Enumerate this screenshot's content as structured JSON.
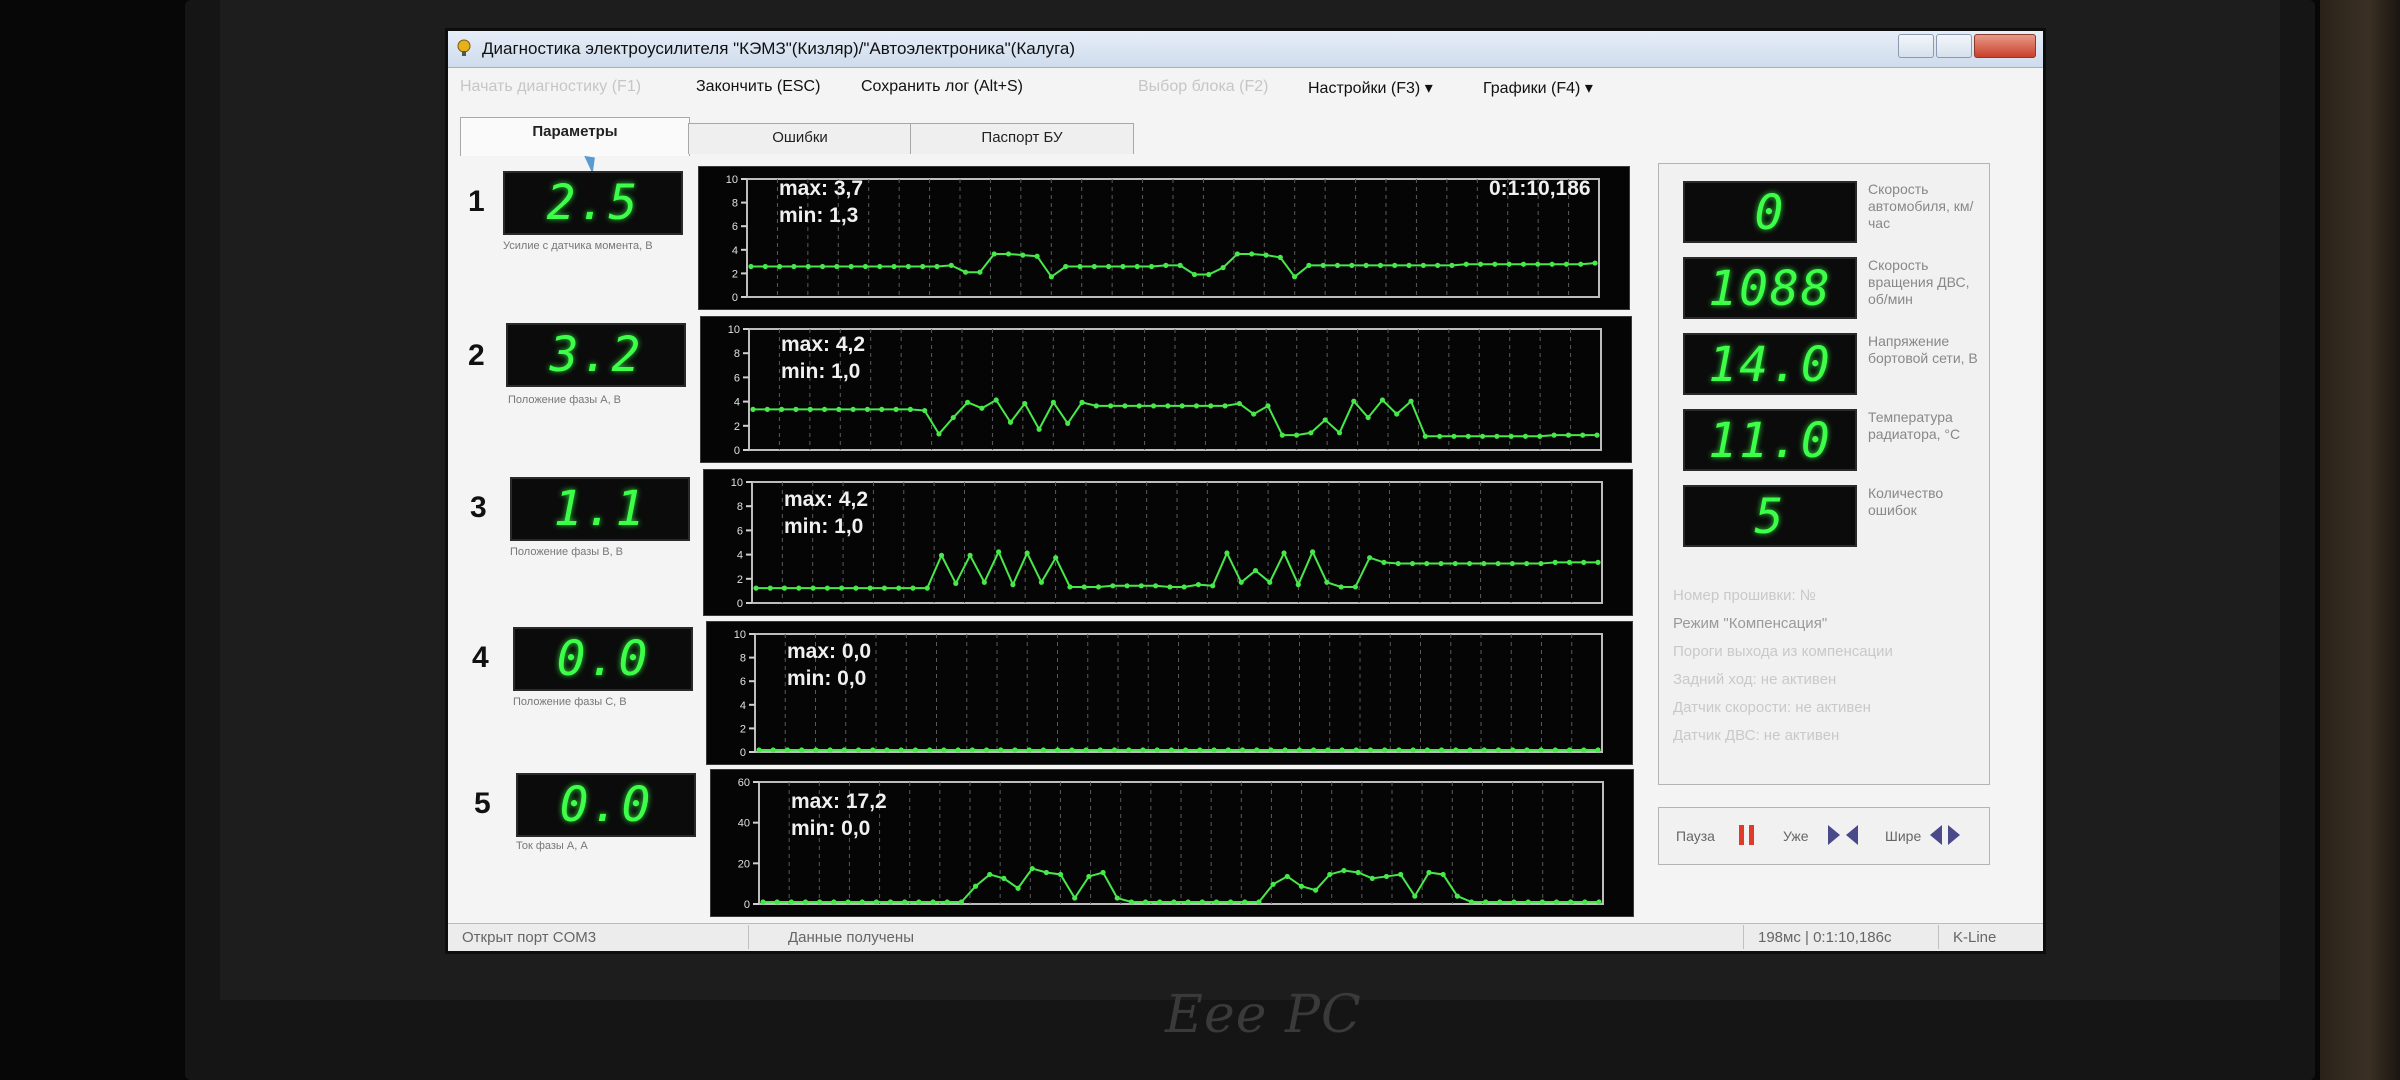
{
  "window": {
    "title": "Диагностика электроусилителя \"КЭМЗ\"(Кизляр)/\"Автоэлектроника\"(Калуга)"
  },
  "menu": {
    "start": "Начать диагностику (F1)",
    "finish": "Закончить (ESC)",
    "save_log": "Сохранить лог (Alt+S)",
    "select_block": "Выбор блока (F2)",
    "settings": "Настройки (F3)",
    "graphs": "Графики (F4)"
  },
  "tabs": [
    {
      "label": "Параметры",
      "active": true
    },
    {
      "label": "Ошибки",
      "active": false
    },
    {
      "label": "Паспорт БУ",
      "active": false
    }
  ],
  "params": [
    {
      "num": "1",
      "value": "2.5",
      "label": "Усилие с датчика момента, В",
      "max": "max: 3,7",
      "min": "min: 1,3",
      "ymax": 10,
      "yticks": [
        "10",
        "8",
        "6",
        "4",
        "2",
        "0"
      ]
    },
    {
      "num": "2",
      "value": "3.2",
      "label": "Положение фазы А, В",
      "max": "max: 4,2",
      "min": "min: 1,0",
      "ymax": 10,
      "yticks": [
        "10",
        "8",
        "6",
        "4",
        "2",
        "0"
      ]
    },
    {
      "num": "3",
      "value": "1.1",
      "label": "Положение фазы В, В",
      "max": "max: 4,2",
      "min": "min: 1,0",
      "ymax": 10,
      "yticks": [
        "10",
        "8",
        "6",
        "4",
        "2",
        "0"
      ]
    },
    {
      "num": "4",
      "value": "0.0",
      "label": "Положение фазы С, В",
      "max": "max: 0,0",
      "min": "min: 0,0",
      "ymax": 10,
      "yticks": [
        "10",
        "8",
        "6",
        "4",
        "2",
        "0"
      ]
    },
    {
      "num": "5",
      "value": "0.0",
      "label": "Ток фазы А, А",
      "max": "max: 17,2",
      "min": "min: 0,0",
      "ymax": 60,
      "yticks": [
        "60",
        "40",
        "20",
        "0"
      ]
    }
  ],
  "graph_time": "0:1:10,186",
  "side": [
    {
      "value": "0",
      "label": "Скорость автомобиля, км/час"
    },
    {
      "value": "1088",
      "label": "Скорость вращения ДВС, об/мин"
    },
    {
      "value": "14.0",
      "label": "Напряжение бортовой сети, В"
    },
    {
      "value": "11.0",
      "label": "Температура радиатора, °С"
    },
    {
      "value": "5",
      "label": "Количество ошибок"
    }
  ],
  "side_text": {
    "line1": "Номер прошивки: №",
    "mode": "Режим \"Компенсация\"",
    "line3": "Пороги выхода из компенсации",
    "line4": "Задний ход: не активен",
    "line5": "Датчик скорости: не активен",
    "line6": "Датчик ДВС: не активен"
  },
  "controls": {
    "pause": "Пауза",
    "narrower": "Уже",
    "wider": "Шире"
  },
  "status": {
    "port": "Открыт порт COM3",
    "data": "Данные получены",
    "timing": "198мс | 0:1:10,186с",
    "protocol": "K-Line"
  },
  "colors": {
    "trace": "#46e84a",
    "seg_digit": "#3dff4a",
    "plot_bg": "#050505",
    "pause_icon": "#e03a2a",
    "arrow_icon": "#4a4a8a"
  },
  "chart_data": [
    {
      "type": "line",
      "title": "",
      "ylim": [
        0,
        10
      ],
      "series": [
        {
          "values": [
            2.5,
            2.5,
            2.5,
            2.5,
            2.5,
            2.5,
            2.5,
            2.5,
            2.5,
            2.5,
            2.5,
            2.5,
            2.5,
            2.5,
            2.6,
            2.0,
            2.0,
            3.6,
            3.6,
            3.5,
            3.4,
            1.6,
            2.5,
            2.5,
            2.5,
            2.5,
            2.5,
            2.5,
            2.5,
            2.6,
            2.6,
            1.8,
            1.8,
            2.4,
            3.6,
            3.6,
            3.5,
            3.3,
            1.6,
            2.6,
            2.6,
            2.6,
            2.6,
            2.6,
            2.6,
            2.6,
            2.6,
            2.6,
            2.6,
            2.6,
            2.7,
            2.7,
            2.7,
            2.7,
            2.7,
            2.7,
            2.7,
            2.7,
            2.7,
            2.8
          ]
        }
      ]
    },
    {
      "type": "line",
      "title": "",
      "ylim": [
        0,
        10
      ],
      "series": [
        {
          "values": [
            3.3,
            3.3,
            3.3,
            3.3,
            3.3,
            3.3,
            3.3,
            3.3,
            3.3,
            3.3,
            3.3,
            3.3,
            3.2,
            1.2,
            2.6,
            3.9,
            3.4,
            4.1,
            2.2,
            3.8,
            1.6,
            3.9,
            2.1,
            3.9,
            3.6,
            3.6,
            3.6,
            3.6,
            3.6,
            3.6,
            3.6,
            3.6,
            3.6,
            3.6,
            3.8,
            2.9,
            3.6,
            1.1,
            1.1,
            1.3,
            2.4,
            1.3,
            4.0,
            2.6,
            4.1,
            2.9,
            4.0,
            1.0,
            1.0,
            1.0,
            1.0,
            1.0,
            1.0,
            1.0,
            1.0,
            1.0,
            1.1,
            1.1,
            1.1,
            1.1
          ]
        }
      ]
    },
    {
      "type": "line",
      "title": "",
      "ylim": [
        0,
        10
      ],
      "series": [
        {
          "values": [
            1.1,
            1.1,
            1.1,
            1.1,
            1.1,
            1.1,
            1.1,
            1.1,
            1.1,
            1.1,
            1.1,
            1.1,
            1.1,
            3.9,
            1.5,
            3.9,
            1.6,
            4.2,
            1.4,
            4.1,
            1.6,
            3.7,
            1.2,
            1.2,
            1.2,
            1.3,
            1.3,
            1.3,
            1.3,
            1.2,
            1.2,
            1.4,
            1.3,
            4.1,
            1.6,
            2.6,
            1.6,
            4.1,
            1.4,
            4.2,
            1.6,
            1.2,
            1.2,
            3.7,
            3.3,
            3.2,
            3.2,
            3.2,
            3.2,
            3.2,
            3.2,
            3.2,
            3.2,
            3.2,
            3.2,
            3.2,
            3.3,
            3.3,
            3.3,
            3.3
          ]
        }
      ]
    },
    {
      "type": "line",
      "title": "",
      "ylim": [
        0,
        10
      ],
      "series": [
        {
          "values": [
            0,
            0,
            0,
            0,
            0,
            0,
            0,
            0,
            0,
            0,
            0,
            0,
            0,
            0,
            0,
            0,
            0,
            0,
            0,
            0,
            0,
            0,
            0,
            0,
            0,
            0,
            0,
            0,
            0,
            0,
            0,
            0,
            0,
            0,
            0,
            0,
            0,
            0,
            0,
            0,
            0,
            0,
            0,
            0,
            0,
            0,
            0,
            0,
            0,
            0,
            0,
            0,
            0,
            0,
            0,
            0,
            0,
            0,
            0,
            0
          ]
        }
      ]
    },
    {
      "type": "line",
      "title": "",
      "ylim": [
        0,
        60
      ],
      "series": [
        {
          "values": [
            0,
            0,
            0,
            0,
            0,
            0,
            0,
            0,
            0,
            0,
            0,
            0,
            0,
            0,
            0,
            8,
            14,
            12,
            7,
            17,
            15,
            14,
            2,
            13,
            15,
            2,
            0,
            0,
            0,
            0,
            0,
            0,
            0,
            0,
            0,
            0,
            9,
            13,
            8,
            6,
            14,
            16,
            15,
            12,
            13,
            14,
            3,
            15,
            14,
            3,
            0,
            0,
            0,
            0,
            0,
            0,
            0,
            0,
            0,
            0
          ]
        }
      ]
    }
  ]
}
